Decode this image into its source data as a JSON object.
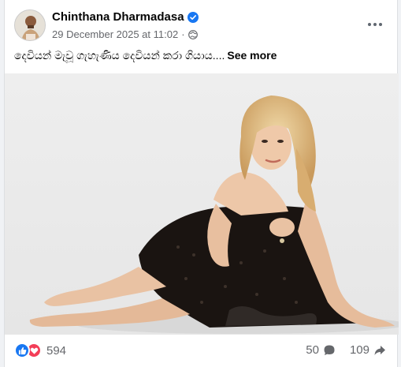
{
  "post": {
    "author": "Chinthana Dharmadasa",
    "timestamp": "29 December 2025 at 11:02",
    "separator": "·",
    "privacy_icon": "globe-icon",
    "verified_icon": "verified-badge-icon",
    "caption": "දෙවියන් මැවූ ගැහැණිය දෙවියන් කරා ගියාය....",
    "see_more": "See more"
  },
  "engagement": {
    "reactions_count": "594",
    "reaction_icons": [
      "like-icon",
      "love-icon"
    ],
    "comments_count": "50",
    "shares_count": "109"
  },
  "colors": {
    "accent": "#1877f2",
    "love": "#f33e58",
    "muted_text": "#65676b"
  }
}
